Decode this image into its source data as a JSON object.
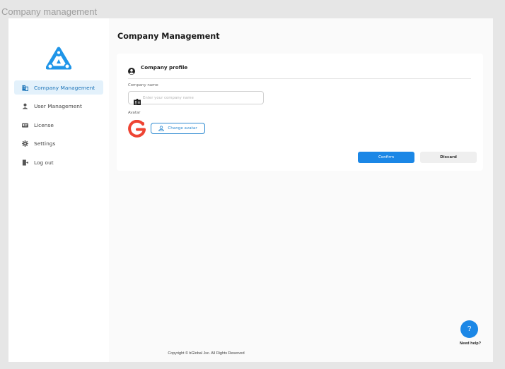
{
  "window": {
    "title": "Company management"
  },
  "sidebar": {
    "items": [
      {
        "label": "Company Management",
        "icon": "building-icon",
        "active": true
      },
      {
        "label": "User Management",
        "icon": "user-icon",
        "active": false
      },
      {
        "label": "License",
        "icon": "license-card-icon",
        "active": false
      },
      {
        "label": "Settings",
        "icon": "gear-icon",
        "active": false
      },
      {
        "label": "Log out",
        "icon": "logout-door-icon",
        "active": false
      }
    ]
  },
  "main": {
    "title": "Company Management",
    "card": {
      "header": "Company profile",
      "company_name": {
        "label": "Company name",
        "placeholder": "Enter your company name",
        "value": ""
      },
      "avatar": {
        "label": "Avatar",
        "change_button": "Change avatar"
      },
      "confirm_label": "Confirm",
      "discard_label": "Discard"
    }
  },
  "footer": {
    "copyright": "Copyright © bGlobal Jsc. All Rights Reserved"
  },
  "help": {
    "icon_text": "?",
    "label": "Need help?"
  },
  "colors": {
    "accent": "#1b87e6",
    "active_nav_bg": "#e3f1fb",
    "avatar_red": "#ee4433",
    "logo_blue": "#1f95e8"
  }
}
